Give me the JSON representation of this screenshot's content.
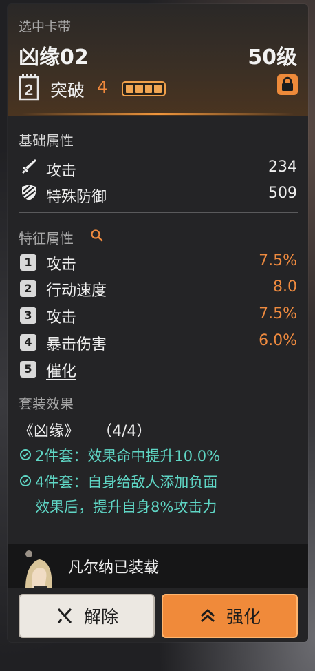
{
  "header": {
    "subtitle": "选中卡带",
    "name": "凶缘02",
    "level": "50级",
    "slot_number": "2",
    "breakthrough_label": "突破",
    "breakthrough_value": "4",
    "breakthrough_pips": 4,
    "lock_icon": "lock-icon"
  },
  "base_attributes": {
    "title": "基础属性",
    "items": [
      {
        "icon": "sword-icon",
        "label": "攻击",
        "value": "234"
      },
      {
        "icon": "shield-stripes-icon",
        "label": "特殊防御",
        "value": "509"
      }
    ]
  },
  "feature_attributes": {
    "title": "特征属性",
    "search_icon": "search-icon",
    "items": [
      {
        "num": "1",
        "label": "攻击",
        "value": "7.5%"
      },
      {
        "num": "2",
        "label": "行动速度",
        "value": "8.0"
      },
      {
        "num": "3",
        "label": "攻击",
        "value": "7.5%"
      },
      {
        "num": "4",
        "label": "暴击伤害",
        "value": "6.0%"
      },
      {
        "num": "5",
        "label": "催化",
        "value": ""
      }
    ]
  },
  "set_effect": {
    "title": "套装效果",
    "set_name": "《凶缘》",
    "set_count": "（4/4）",
    "lines": [
      "2件套：效果命中提升10.0%",
      "4件套：自身给敌人添加负面",
      "效果后，提升自身8%攻击力"
    ]
  },
  "equipped": {
    "text": "凡尔纳已装载"
  },
  "buttons": {
    "unequip": "解除",
    "enhance": "强化"
  },
  "colors": {
    "accent_orange": "#ee8a3f",
    "set_teal": "#5fd6c5",
    "panel_bg": "#242426"
  }
}
